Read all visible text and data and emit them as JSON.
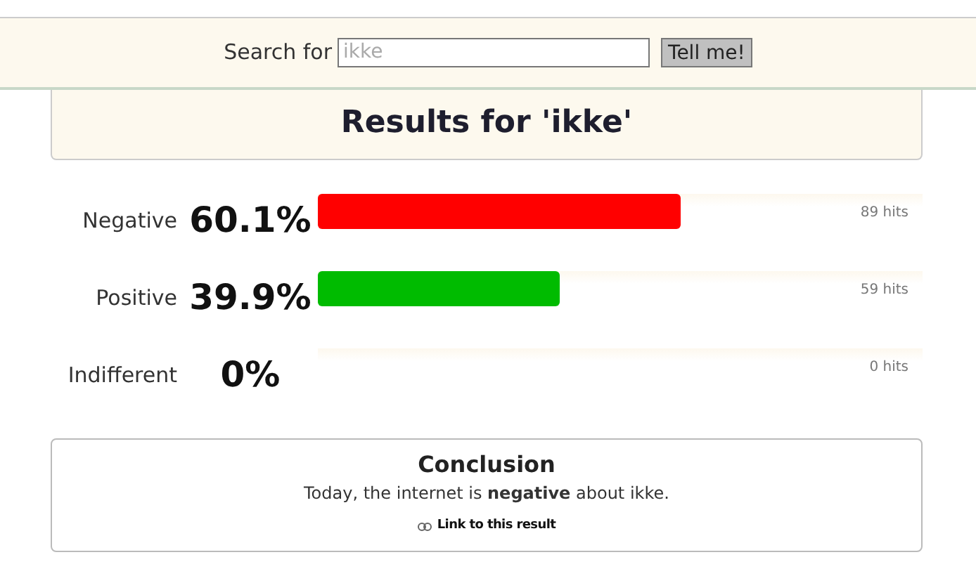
{
  "search": {
    "label": "Search for",
    "placeholder": "ikke",
    "button": "Tell me!"
  },
  "title": "Results for 'ikke'",
  "results": [
    {
      "label": "Negative",
      "percent": "60.1%",
      "level": 0.601,
      "color": "#ff0000",
      "hits": "89 hits"
    },
    {
      "label": "Positive",
      "percent": "39.9%",
      "level": 0.399,
      "color": "#00bb00",
      "hits": "59 hits"
    },
    {
      "label": "Indifferent",
      "percent": "0%",
      "hits": "0 hits"
    }
  ],
  "conclusion": {
    "title": "Conclusion",
    "text": "Today, the internet is **negative** about ikke.",
    "link": "Link to this result"
  }
}
